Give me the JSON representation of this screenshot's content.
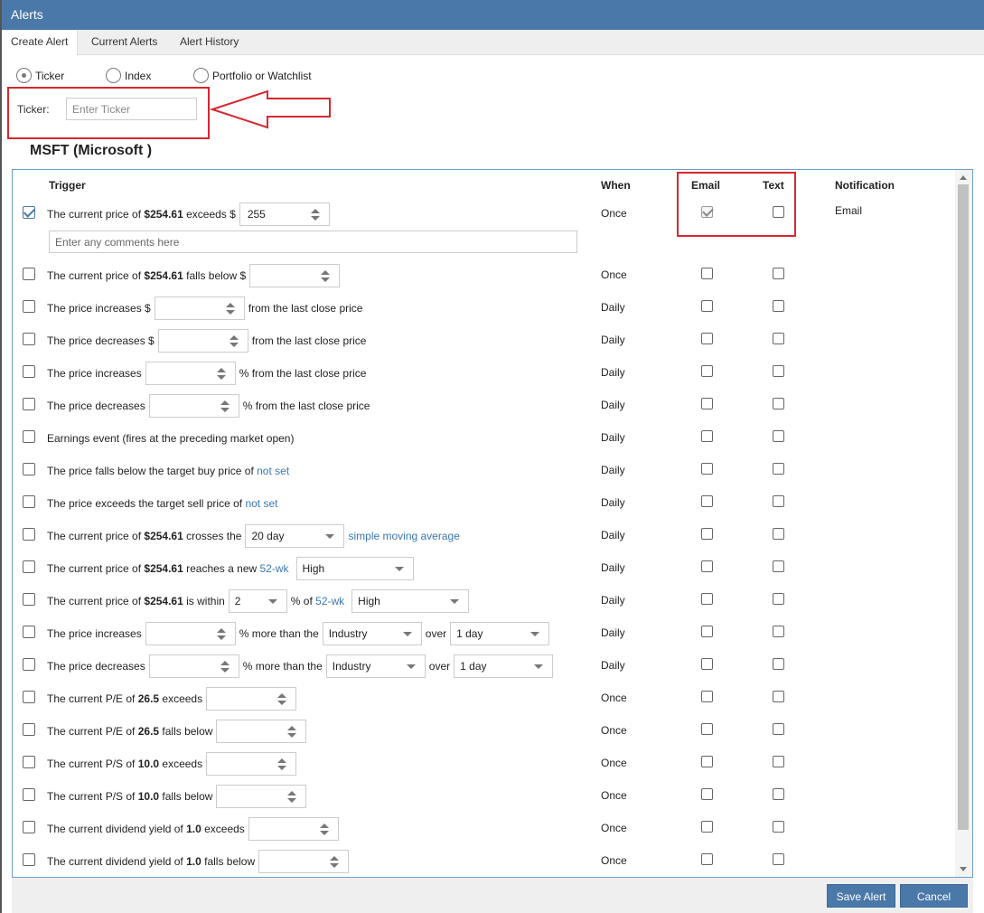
{
  "window": {
    "title": "Alerts"
  },
  "tabs": [
    "Create Alert",
    "Current Alerts",
    "Alert History"
  ],
  "source_options": [
    {
      "label": "Ticker",
      "selected": true
    },
    {
      "label": "Index",
      "selected": false
    },
    {
      "label": "Portfolio or Watchlist",
      "selected": false
    }
  ],
  "ticker": {
    "label": "Ticker:",
    "placeholder": "Enter Ticker"
  },
  "company": "MSFT (Microsoft )",
  "columns": {
    "trigger": "Trigger",
    "when": "When",
    "email": "Email",
    "text": "Text",
    "notification": "Notification"
  },
  "comment_placeholder": "Enter any comments here",
  "rows": [
    {
      "checked": true,
      "parts": [
        {
          "t": "The current price of "
        },
        {
          "b": "$254.61"
        },
        {
          "t": " exceeds $"
        },
        {
          "spin": "255"
        }
      ],
      "when": "Once",
      "email": true,
      "text": false,
      "notification": "Email"
    },
    {
      "parts": [
        {
          "t": "The current price of "
        },
        {
          "b": "$254.61"
        },
        {
          "t": " falls below $"
        },
        {
          "spin": ""
        }
      ],
      "when": "Once"
    },
    {
      "parts": [
        {
          "t": "The price increases $"
        },
        {
          "spin": ""
        },
        {
          "t": "from the last close price"
        }
      ],
      "when": "Daily"
    },
    {
      "parts": [
        {
          "t": "The price decreases $"
        },
        {
          "spin": ""
        },
        {
          "t": "from the last close price"
        }
      ],
      "when": "Daily"
    },
    {
      "parts": [
        {
          "t": "The price increases"
        },
        {
          "spin": ""
        },
        {
          "t": "% from the last close price"
        }
      ],
      "when": "Daily"
    },
    {
      "parts": [
        {
          "t": "The price decreases"
        },
        {
          "spin": ""
        },
        {
          "t": "% from the last close price"
        }
      ],
      "when": "Daily"
    },
    {
      "parts": [
        {
          "t": "Earnings event (fires at the preceding market open)"
        }
      ],
      "when": "Daily"
    },
    {
      "parts": [
        {
          "t": "The price falls below the target buy price of "
        },
        {
          "link": "not set"
        }
      ],
      "when": "Daily"
    },
    {
      "parts": [
        {
          "t": "The price exceeds the target sell price of "
        },
        {
          "link": "not set"
        }
      ],
      "when": "Daily"
    },
    {
      "parts": [
        {
          "t": "The current price of "
        },
        {
          "b": "$254.61"
        },
        {
          "t": " crosses the"
        },
        {
          "select": "20 day",
          "w": 110
        },
        {
          "link": "simple moving average"
        }
      ],
      "when": "Daily"
    },
    {
      "parts": [
        {
          "t": "The current price of "
        },
        {
          "b": "$254.61"
        },
        {
          "t": " reaches a new "
        },
        {
          "link": "52-wk"
        },
        {
          "select": "High",
          "w": 130
        }
      ],
      "when": "Daily"
    },
    {
      "parts": [
        {
          "t": "The current price of "
        },
        {
          "b": "$254.61"
        },
        {
          "t": " is within"
        },
        {
          "select": "2",
          "w": 65
        },
        {
          "t": "% of "
        },
        {
          "link": "52-wk"
        },
        {
          "select": "High",
          "w": 130
        }
      ],
      "when": "Daily"
    },
    {
      "parts": [
        {
          "t": "The price increases"
        },
        {
          "spin": ""
        },
        {
          "t": "% more than the"
        },
        {
          "select": "Industry",
          "w": 110
        },
        {
          "t": "over"
        },
        {
          "select": "1 day",
          "w": 110
        }
      ],
      "when": "Daily"
    },
    {
      "parts": [
        {
          "t": "The price decreases"
        },
        {
          "spin": ""
        },
        {
          "t": "% more than the"
        },
        {
          "select": "Industry",
          "w": 110
        },
        {
          "t": "over"
        },
        {
          "select": "1 day",
          "w": 110
        }
      ],
      "when": "Daily"
    },
    {
      "parts": [
        {
          "t": "The current P/E of "
        },
        {
          "b": "26.5"
        },
        {
          "t": " exceeds"
        },
        {
          "spin": "",
          "w": 100
        }
      ],
      "when": "Once"
    },
    {
      "parts": [
        {
          "t": "The current P/E of "
        },
        {
          "b": "26.5"
        },
        {
          "t": " falls below"
        },
        {
          "spin": "",
          "w": 100
        }
      ],
      "when": "Once"
    },
    {
      "parts": [
        {
          "t": "The current P/S of "
        },
        {
          "b": "10.0"
        },
        {
          "t": " exceeds"
        },
        {
          "spin": "",
          "w": 100
        }
      ],
      "when": "Once"
    },
    {
      "parts": [
        {
          "t": "The current P/S of "
        },
        {
          "b": "10.0"
        },
        {
          "t": " falls below"
        },
        {
          "spin": "",
          "w": 100
        }
      ],
      "when": "Once"
    },
    {
      "parts": [
        {
          "t": "The current dividend yield of "
        },
        {
          "b": "1.0"
        },
        {
          "t": " exceeds"
        },
        {
          "spin": "",
          "w": 100
        }
      ],
      "when": "Once"
    },
    {
      "parts": [
        {
          "t": "The current dividend yield of "
        },
        {
          "b": "1.0"
        },
        {
          "t": " falls below"
        },
        {
          "spin": "",
          "w": 100
        }
      ],
      "when": "Once"
    }
  ],
  "buttons": {
    "save": "Save Alert",
    "cancel": "Cancel"
  },
  "colors": {
    "title_bar": "#4a78a9",
    "accent": "#4a78a9",
    "annotation": "#d62730",
    "link": "#3a78b5"
  }
}
